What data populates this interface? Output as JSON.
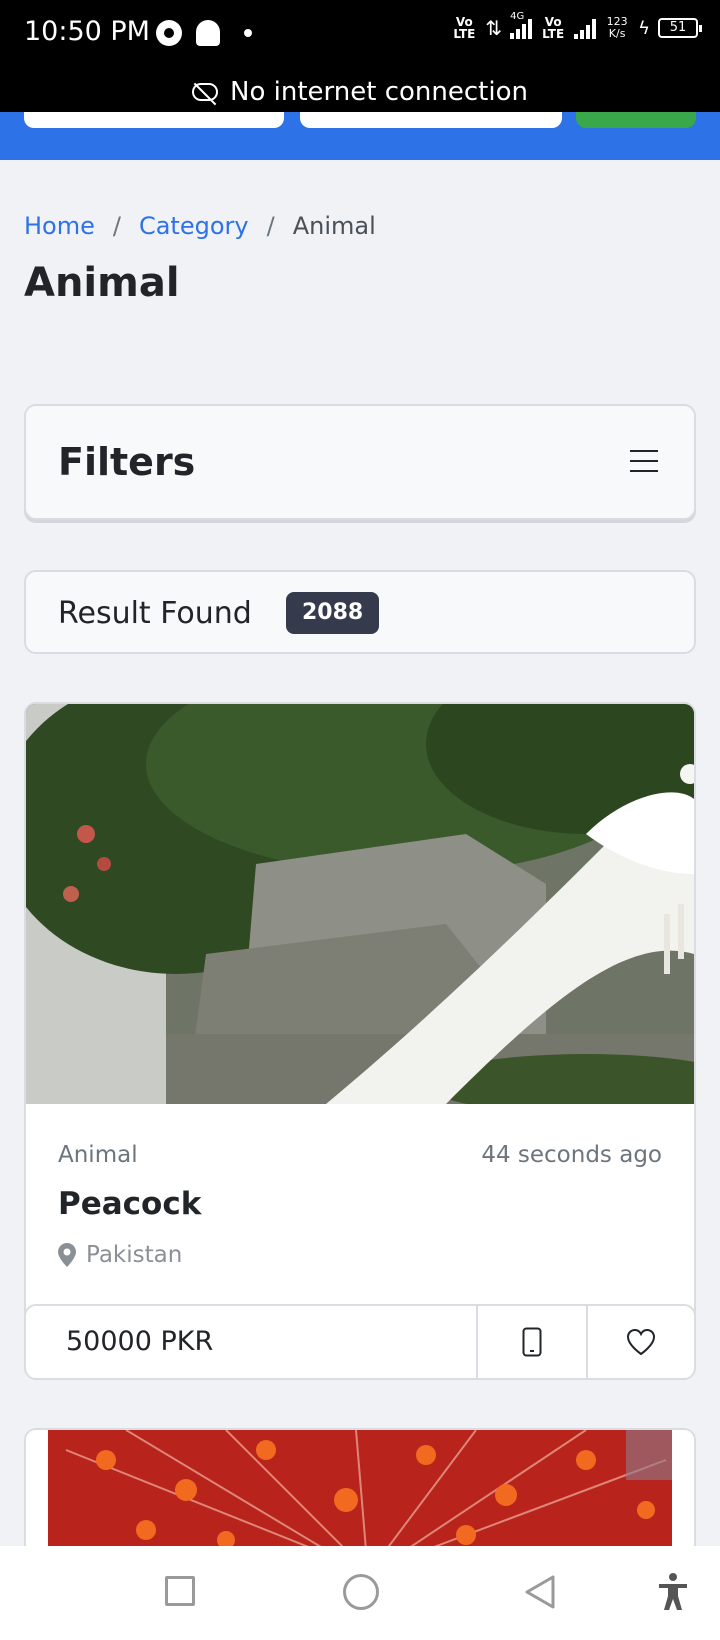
{
  "status_bar": {
    "time": "10:50 PM",
    "vo_lte_1": "Vo LTE",
    "network_4g": "4G",
    "vo_lte_2": "Vo LTE",
    "speed": "123 K/s",
    "battery": "51"
  },
  "banner": {
    "text": "No internet connection"
  },
  "breadcrumb": {
    "home": "Home",
    "category": "Category",
    "current": "Animal",
    "separator": "/"
  },
  "page": {
    "title": "Animal"
  },
  "filters": {
    "title": "Filters"
  },
  "results": {
    "label": "Result Found",
    "count": "2088"
  },
  "listing": {
    "category": "Animal",
    "time": "44 seconds ago",
    "title": "Peacock",
    "location": "Pakistan",
    "price": "50000 PKR"
  },
  "colors": {
    "accent": "#2e72e8",
    "badge": "#353a4c",
    "green": "#38a84a"
  }
}
